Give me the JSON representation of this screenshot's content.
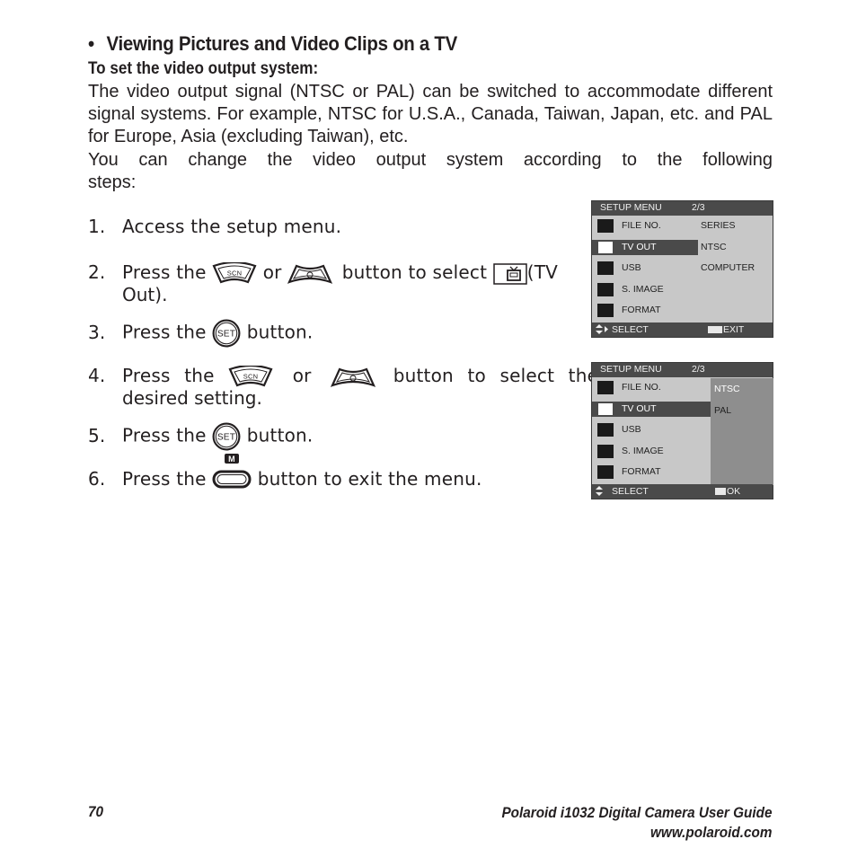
{
  "heading": {
    "bullet": "•",
    "title": "Viewing Pictures and Video Clips on a TV",
    "subtitle": "To set the video output system:"
  },
  "intro": {
    "paragraph1": "The video output signal (NTSC or PAL) can be switched to accommodate different signal systems. For example, NTSC for U.S.A., Canada, Taiwan, Japan, etc. and PAL for Europe, Asia (excluding Taiwan), etc.",
    "paragraph2_line1": "You can change the video output system according to the following",
    "paragraph2_line2": "steps:"
  },
  "steps": [
    {
      "num": "1.",
      "text": "Access the setup menu."
    },
    {
      "num": "2.",
      "pre": "Press the",
      "mid": "or",
      "post": "button to select",
      "post2": "(TV",
      "cont": "Out)."
    },
    {
      "num": "3.",
      "pre": "Press the",
      "post": "button."
    },
    {
      "num": "4.",
      "pre": "Press the",
      "mid": "or",
      "post": "button to select the",
      "cont": "desired setting."
    },
    {
      "num": "5.",
      "pre": "Press the",
      "post": "button."
    },
    {
      "num": "6.",
      "pre": "Press the",
      "post": "button to exit the menu."
    }
  ],
  "icons": {
    "scn_label": "SCN",
    "set_label": "SET",
    "menu_label": "M"
  },
  "screen1": {
    "header": "SETUP MENU",
    "page": "2/3",
    "items": [
      {
        "label": "FILE NO.",
        "value": "SERIES"
      },
      {
        "label": "TV OUT",
        "value": "NTSC"
      },
      {
        "label": "USB",
        "value": "COMPUTER"
      },
      {
        "label": "S. IMAGE",
        "value": ""
      },
      {
        "label": "FORMAT",
        "value": ""
      }
    ],
    "footer_select": "SELECT",
    "footer_action": "EXIT"
  },
  "screen2": {
    "header": "SETUP MENU",
    "page": "2/3",
    "items": [
      {
        "label": "FILE NO."
      },
      {
        "label": "TV OUT"
      },
      {
        "label": "USB"
      },
      {
        "label": "S. IMAGE"
      },
      {
        "label": "FORMAT"
      }
    ],
    "options": [
      "NTSC",
      "PAL"
    ],
    "footer_select": "SELECT",
    "footer_action": "OK"
  },
  "footer": {
    "page_number": "70",
    "guide_title": "Polaroid i1032 Digital Camera User Guide",
    "website": "www.polaroid.com"
  }
}
